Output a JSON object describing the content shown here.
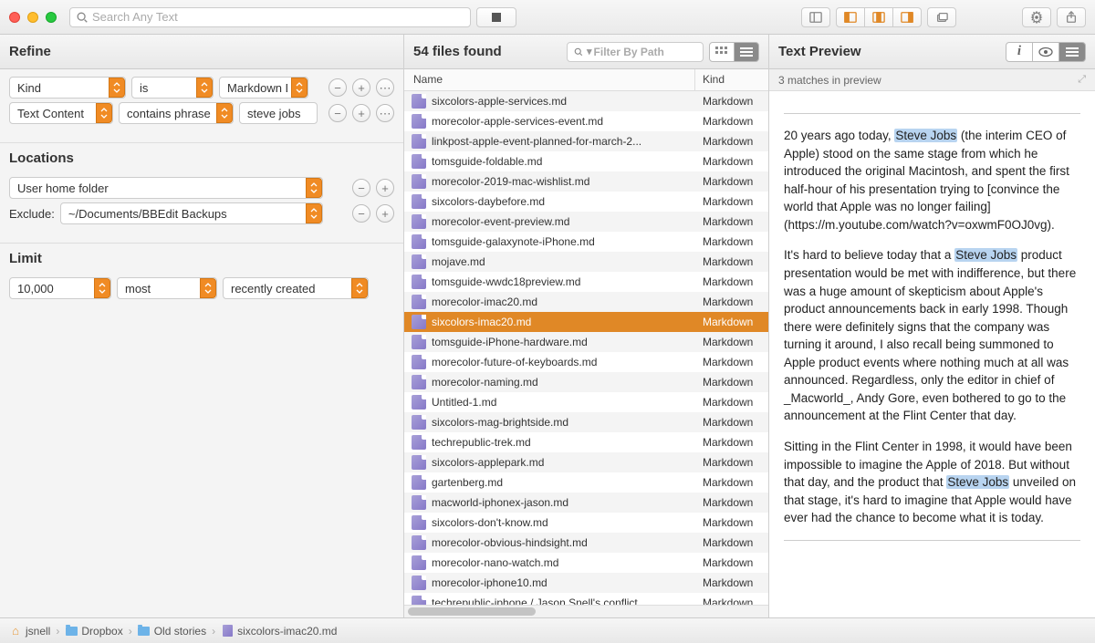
{
  "toolbar": {
    "search_placeholder": "Search Any Text"
  },
  "refine": {
    "title": "Refine",
    "row1": {
      "field": "Kind",
      "op": "is",
      "value": "Markdown D"
    },
    "row2": {
      "field": "Text Content",
      "op": "contains phrase",
      "value": "steve jobs"
    },
    "locations_title": "Locations",
    "location_value": "User home folder",
    "exclude_label": "Exclude:",
    "exclude_value": "~/Documents/BBEdit Backups",
    "limit_title": "Limit",
    "limit_count": "10,000",
    "limit_qual": "most",
    "limit_mode": "recently created"
  },
  "files": {
    "count_label": "54 files found",
    "filter_placeholder": "Filter By Path",
    "col_name": "Name",
    "col_kind": "Kind",
    "kind": "Markdown",
    "rows": [
      "sixcolors-apple-services.md",
      "morecolor-apple-services-event.md",
      "linkpost-apple-event-planned-for-march-2...",
      "tomsguide-foldable.md",
      "morecolor-2019-mac-wishlist.md",
      "sixcolors-daybefore.md",
      "morecolor-event-preview.md",
      "tomsguide-galaxynote-iPhone.md",
      "mojave.md",
      "tomsguide-wwdc18preview.md",
      "morecolor-imac20.md",
      "sixcolors-imac20.md",
      "tomsguide-iPhone-hardware.md",
      "morecolor-future-of-keyboards.md",
      "morecolor-naming.md",
      "Untitled-1.md",
      "sixcolors-mag-brightside.md",
      "techrepublic-trek.md",
      "sixcolors-applepark.md",
      "gartenberg.md",
      "macworld-iphonex-jason.md",
      "sixcolors-don't-know.md",
      "morecolor-obvious-hindsight.md",
      "morecolor-nano-watch.md",
      "morecolor-iphone10.md",
      "techrepublic-iphone / Jason Snell's conflict"
    ],
    "selected_index": 11
  },
  "preview": {
    "title": "Text Preview",
    "matches_label": "3 matches in preview",
    "p1a": "20 years ago today, ",
    "hl": "Steve Jobs",
    "p1b": " (the interim CEO of Apple) stood on the same stage from which he introduced the original Macintosh, and spent the first half-hour of his presentation trying to [convince the world that Apple was no longer failing](https://m.youtube.com/watch?v=oxwmF0OJ0vg).",
    "p2a": "It's hard to believe today that a ",
    "p2b": " product presentation would be met with indifference, but there was a huge amount of skepticism about Apple's product announcements back in early 1998. Though there were definitely signs that the company was turning it around, I also recall being summoned to Apple product events where nothing much at all was announced. Regardless, only the editor in chief of _Macworld_, Andy Gore, even bothered to go to the announcement at the Flint Center that day.",
    "p3a": "Sitting in the Flint Center in 1998, it would have been impossible to imagine the Apple of 2018. But without that day, and the product that ",
    "p3b": " unveiled on that stage, it's hard to imagine that Apple would have ever had the chance to become what it is today."
  },
  "path": {
    "p1": "jsnell",
    "p2": "Dropbox",
    "p3": "Old stories",
    "p4": "sixcolors-imac20.md"
  }
}
